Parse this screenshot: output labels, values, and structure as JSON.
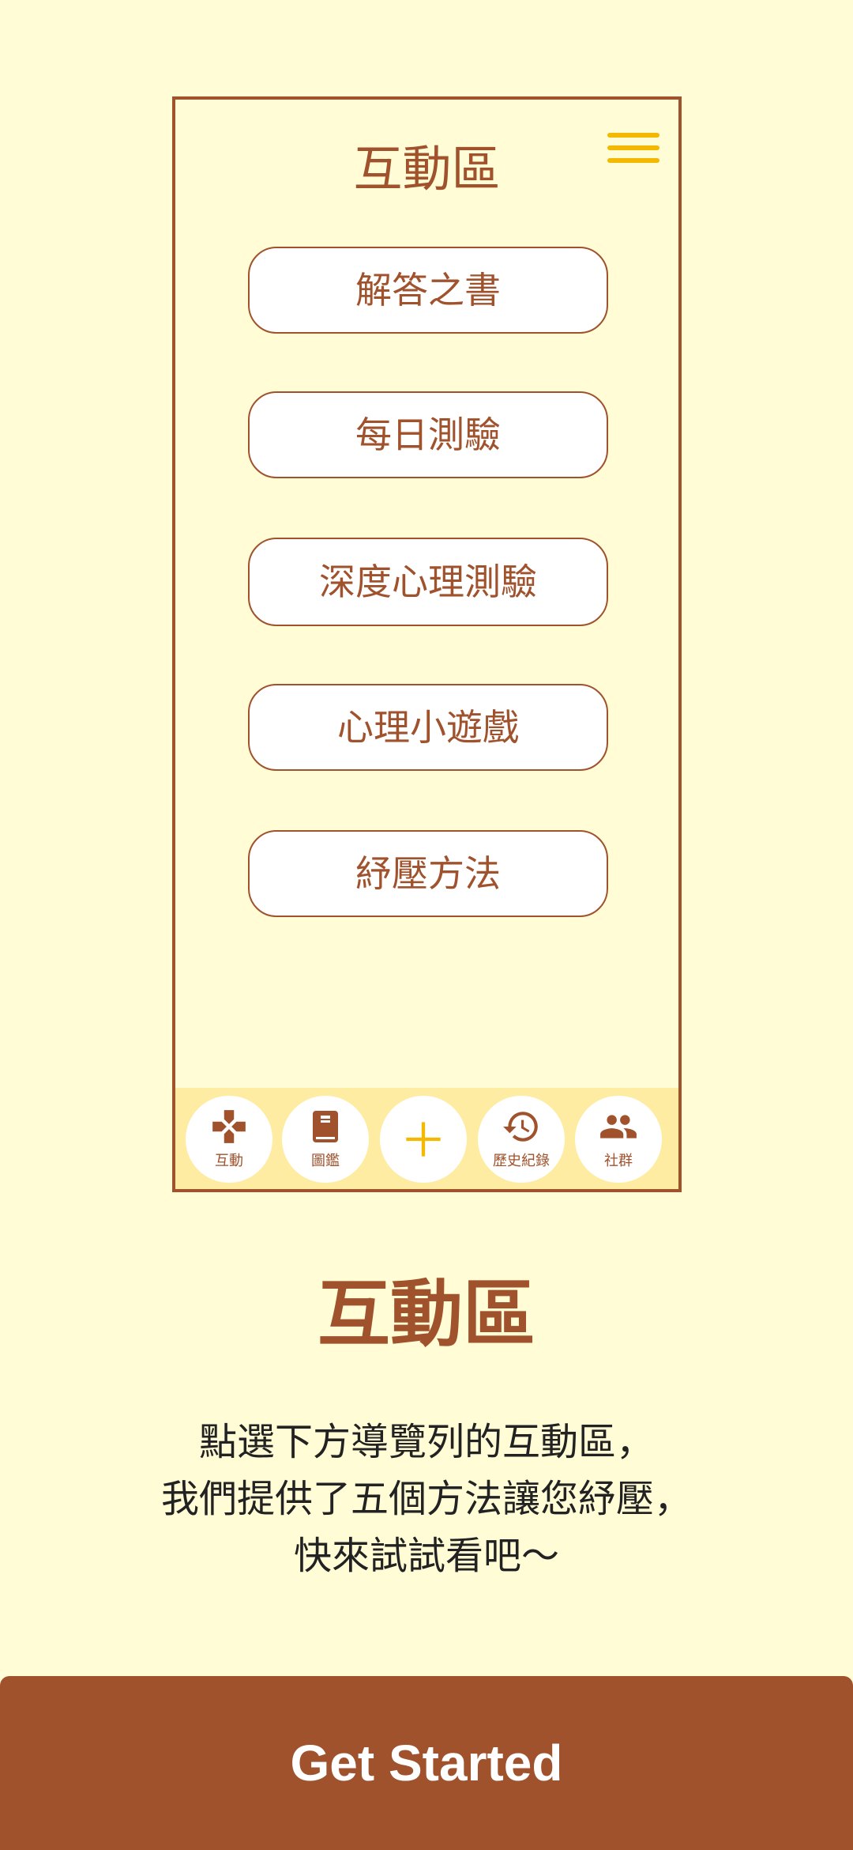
{
  "colors": {
    "background": "#FFFCD6",
    "brand_brown": "#A0522D",
    "accent_yellow": "#F5B800",
    "tabbar_bg": "#FFECA3",
    "button_bg": "#FFFFFF"
  },
  "phone": {
    "title": "互動區",
    "menu_icon": "hamburger-menu-icon",
    "menu_items": [
      {
        "label": "解答之書"
      },
      {
        "label": "每日測驗"
      },
      {
        "label": "深度心理測驗"
      },
      {
        "label": "心理小遊戲"
      },
      {
        "label": "紓壓方法"
      }
    ],
    "tabs": [
      {
        "label": "互動",
        "icon": "gamepad-icon"
      },
      {
        "label": "圖鑑",
        "icon": "book-icon"
      },
      {
        "label": "",
        "icon": "plus-icon"
      },
      {
        "label": "歷史紀錄",
        "icon": "history-icon"
      },
      {
        "label": "社群",
        "icon": "people-icon"
      }
    ]
  },
  "headline": "互動區",
  "description": [
    "點選下方導覽列的互動區，",
    "我們提供了五個方法讓您紓壓，",
    "快來試試看吧～"
  ],
  "cta": {
    "label": "Get Started"
  }
}
